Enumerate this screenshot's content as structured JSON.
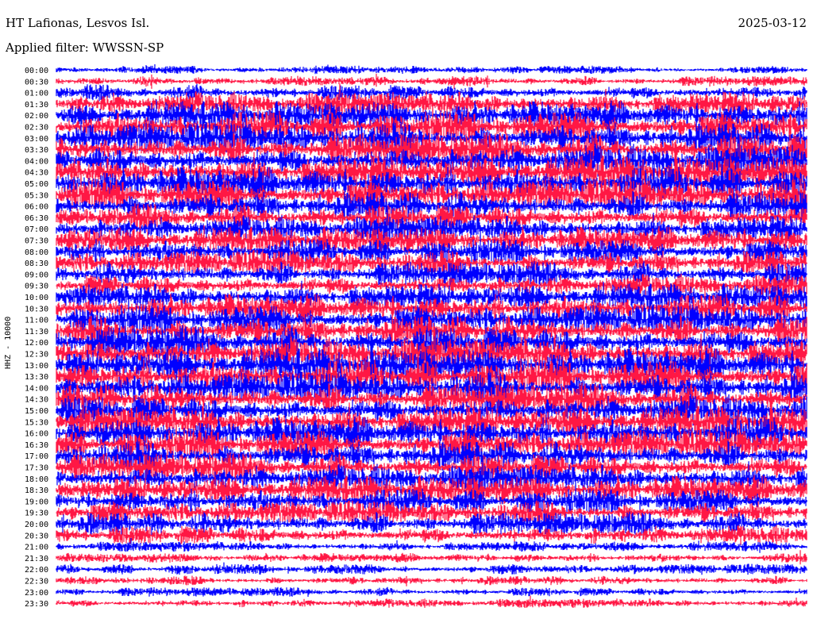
{
  "header": {
    "station": "HT Lafionas, Lesvos Isl.",
    "date": "2025-03-12",
    "filter": "Applied filter: WWSSN-SP"
  },
  "channel_label": "HHZ - 10000",
  "colors": {
    "trace_a": "#0000ff",
    "trace_b": "#ff1744",
    "background": "#ffffff"
  },
  "chart_data": {
    "type": "helicorder",
    "title": "HT Lafionas, Lesvos Isl.",
    "date": "2025-03-12",
    "filter": "WWSSN-SP",
    "ylabel": "HHZ - 10000",
    "line_interval_minutes": 30,
    "alternating_colors": [
      "#0000ff",
      "#ff1744"
    ],
    "rows": [
      {
        "time": "00:00",
        "activity": 0.35
      },
      {
        "time": "00:30",
        "activity": 0.45
      },
      {
        "time": "01:00",
        "activity": 0.5
      },
      {
        "time": "01:30",
        "activity": 0.75
      },
      {
        "time": "02:00",
        "activity": 0.85
      },
      {
        "time": "02:30",
        "activity": 0.95
      },
      {
        "time": "03:00",
        "activity": 0.95
      },
      {
        "time": "03:30",
        "activity": 1.0
      },
      {
        "time": "04:00",
        "activity": 1.0
      },
      {
        "time": "04:30",
        "activity": 1.0
      },
      {
        "time": "05:00",
        "activity": 1.0
      },
      {
        "time": "05:30",
        "activity": 0.95
      },
      {
        "time": "06:00",
        "activity": 0.9
      },
      {
        "time": "06:30",
        "activity": 0.85
      },
      {
        "time": "07:00",
        "activity": 0.8
      },
      {
        "time": "07:30",
        "activity": 0.8
      },
      {
        "time": "08:00",
        "activity": 0.75
      },
      {
        "time": "08:30",
        "activity": 0.75
      },
      {
        "time": "09:00",
        "activity": 0.75
      },
      {
        "time": "09:30",
        "activity": 0.7
      },
      {
        "time": "10:00",
        "activity": 0.8
      },
      {
        "time": "10:30",
        "activity": 0.85
      },
      {
        "time": "11:00",
        "activity": 0.9
      },
      {
        "time": "11:30",
        "activity": 0.95
      },
      {
        "time": "12:00",
        "activity": 1.0
      },
      {
        "time": "12:30",
        "activity": 1.0
      },
      {
        "time": "13:00",
        "activity": 1.0
      },
      {
        "time": "13:30",
        "activity": 1.0
      },
      {
        "time": "14:00",
        "activity": 0.95
      },
      {
        "time": "14:30",
        "activity": 0.95
      },
      {
        "time": "15:00",
        "activity": 0.95
      },
      {
        "time": "15:30",
        "activity": 0.95
      },
      {
        "time": "16:00",
        "activity": 0.95
      },
      {
        "time": "16:30",
        "activity": 0.9
      },
      {
        "time": "17:00",
        "activity": 0.9
      },
      {
        "time": "17:30",
        "activity": 0.85
      },
      {
        "time": "18:00",
        "activity": 0.85
      },
      {
        "time": "18:30",
        "activity": 0.85
      },
      {
        "time": "19:00",
        "activity": 0.75
      },
      {
        "time": "19:30",
        "activity": 0.7
      },
      {
        "time": "20:00",
        "activity": 0.7
      },
      {
        "time": "20:30",
        "activity": 0.6
      },
      {
        "time": "21:00",
        "activity": 0.45
      },
      {
        "time": "21:30",
        "activity": 0.4
      },
      {
        "time": "22:00",
        "activity": 0.45
      },
      {
        "time": "22:30",
        "activity": 0.4
      },
      {
        "time": "23:00",
        "activity": 0.4
      },
      {
        "time": "23:30",
        "activity": 0.4
      }
    ]
  }
}
